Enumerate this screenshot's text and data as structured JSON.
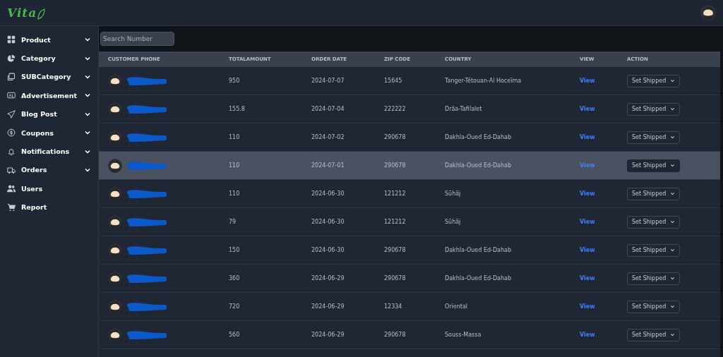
{
  "logo": {
    "text": "Vita"
  },
  "sidebar": {
    "items": [
      {
        "label": "Product",
        "expandable": true
      },
      {
        "label": "Category",
        "expandable": true
      },
      {
        "label": "SUBCategory",
        "expandable": true
      },
      {
        "label": "Advertisement",
        "expandable": true
      },
      {
        "label": "Blog Post",
        "expandable": true
      },
      {
        "label": "Coupons",
        "expandable": true
      },
      {
        "label": "Notifications",
        "expandable": true
      },
      {
        "label": "Orders",
        "expandable": true
      },
      {
        "label": "Users",
        "expandable": false
      },
      {
        "label": "Report",
        "expandable": false
      }
    ]
  },
  "search": {
    "placeholder": "Search Number"
  },
  "table": {
    "columns": [
      "CUSTOMER PHONE",
      "TOTALAMOUNT",
      "ORDER DATE",
      "ZIP CODE",
      "COUNTRY",
      "VIEW",
      "ACTION"
    ],
    "rows": [
      {
        "total": "950",
        "date": "2024-07-07",
        "zip": "15645",
        "country": "Tanger-Tétouan-Al Hoceïma",
        "view": "View",
        "action": "Set Shipped",
        "selected": false
      },
      {
        "total": "155.8",
        "date": "2024-07-04",
        "zip": "222222",
        "country": "Drâa-Tafilalet",
        "view": "View",
        "action": "Set Shipped",
        "selected": false
      },
      {
        "total": "110",
        "date": "2024-07-02",
        "zip": "290678",
        "country": "Dakhla-Oued Ed-Dahab",
        "view": "View",
        "action": "Set Shipped",
        "selected": false
      },
      {
        "total": "110",
        "date": "2024-07-01",
        "zip": "290678",
        "country": "Dakhla-Oued Ed-Dahab",
        "view": "View",
        "action": "Set Shipped",
        "selected": true
      },
      {
        "total": "110",
        "date": "2024-06-30",
        "zip": "121212",
        "country": "Sūhāj",
        "view": "View",
        "action": "Set Shipped",
        "selected": false
      },
      {
        "total": "79",
        "date": "2024-06-30",
        "zip": "121212",
        "country": "Sūhāj",
        "view": "View",
        "action": "Set Shipped",
        "selected": false
      },
      {
        "total": "150",
        "date": "2024-06-30",
        "zip": "290678",
        "country": "Dakhla-Oued Ed-Dahab",
        "view": "View",
        "action": "Set Shipped",
        "selected": false
      },
      {
        "total": "360",
        "date": "2024-06-29",
        "zip": "290678",
        "country": "Dakhla-Oued Ed-Dahab",
        "view": "View",
        "action": "Set Shipped",
        "selected": false
      },
      {
        "total": "720",
        "date": "2024-06-29",
        "zip": "12334",
        "country": "Oriental",
        "view": "View",
        "action": "Set Shipped",
        "selected": false
      },
      {
        "total": "560",
        "date": "2024-06-29",
        "zip": "290678",
        "country": "Souss-Massa",
        "view": "View",
        "action": "Set Shipped",
        "selected": false
      }
    ]
  }
}
